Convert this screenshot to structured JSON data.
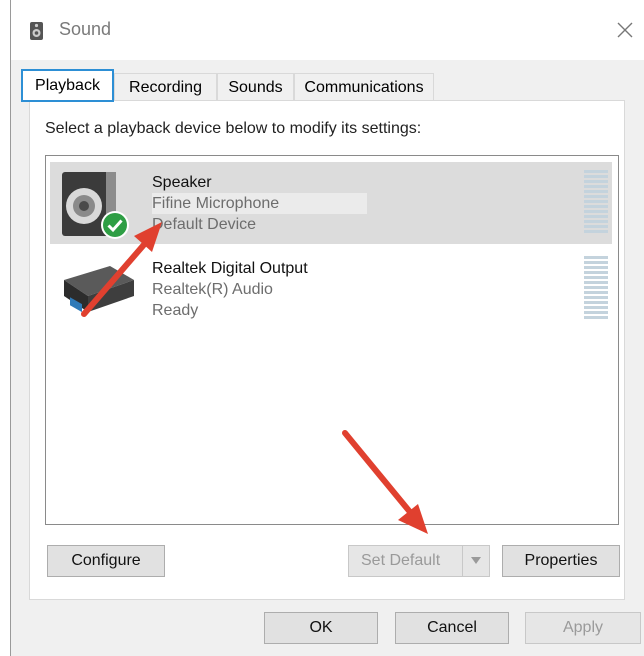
{
  "window": {
    "title": "Sound",
    "close_glyph": "✕"
  },
  "tabs": [
    {
      "label": "Playback",
      "active": true
    },
    {
      "label": "Recording",
      "active": false
    },
    {
      "label": "Sounds",
      "active": false
    },
    {
      "label": "Communications",
      "active": false
    }
  ],
  "playback": {
    "instruction": "Select a playback device below to modify its settings:",
    "devices": [
      {
        "name": "Speaker",
        "description": "Fifine Microphone",
        "status": "Default Device",
        "icon": "speaker-icon",
        "default_badge": "check-badge-icon",
        "selected": true
      },
      {
        "name": "Realtek Digital Output",
        "description": "Realtek(R) Audio",
        "status": "Ready",
        "icon": "digital-output-icon",
        "selected": false
      }
    ]
  },
  "buttons": {
    "configure": "Configure",
    "set_default": "Set Default",
    "properties": "Properties",
    "ok": "OK",
    "cancel": "Cancel",
    "apply": "Apply"
  },
  "colors": {
    "tab_accent": "#2d8fd5",
    "annotation_arrow": "#e0402f",
    "default_badge": "#2e9e44",
    "level_meter": "#c4d3dd"
  }
}
